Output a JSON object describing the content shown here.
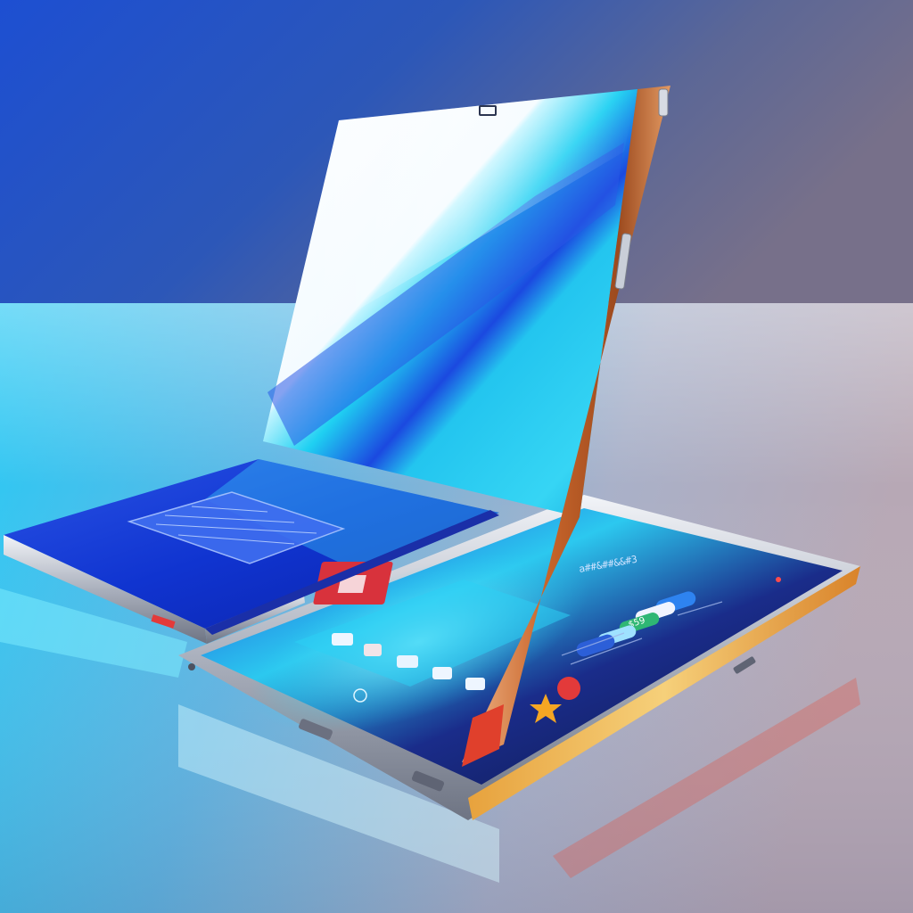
{
  "scene": {
    "subject": "foldable-tablet-device",
    "colors": {
      "backdrop_top_left": "#1f4fcf",
      "backdrop_right": "#6e6a86",
      "table_left": "#27c6f2",
      "table_right": "#b9a9b7",
      "screen_cyan": "#22c8ee",
      "screen_blue": "#0f2fd6",
      "frame_silver": "#c9ced8",
      "hinge_orange": "#d8732c",
      "accent_red": "#e33a3a"
    },
    "screen_ui": {
      "header_text": "a##&##&&#3",
      "value_badge": "$59"
    }
  }
}
